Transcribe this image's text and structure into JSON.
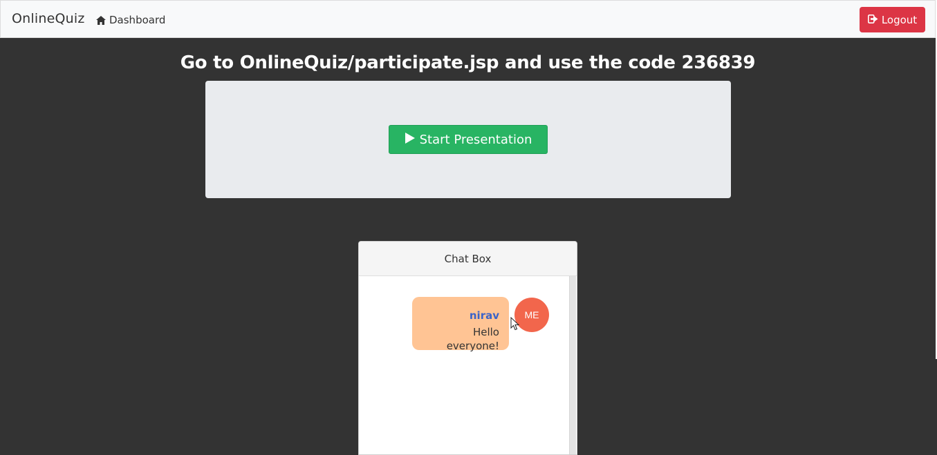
{
  "navbar": {
    "brand": "OnlineQuiz",
    "dashboard_label": "Dashboard",
    "logout_label": "Logout"
  },
  "headline": "Go to OnlineQuiz/participate.jsp and use the code 236839",
  "presentation": {
    "start_label": "Start Presentation"
  },
  "chat": {
    "title": "Chat Box",
    "messages": [
      {
        "author": "nirav",
        "text": "Hello everyone!",
        "avatar": "ME"
      }
    ]
  },
  "icons": {
    "home": "home-icon",
    "logout": "sign-out-icon",
    "play": "play-icon"
  },
  "colors": {
    "background": "#333333",
    "logout": "#dc3545",
    "start": "#28b463",
    "bubble": "#ffc494",
    "author": "#3a63c9",
    "avatar": "#f2664c"
  }
}
